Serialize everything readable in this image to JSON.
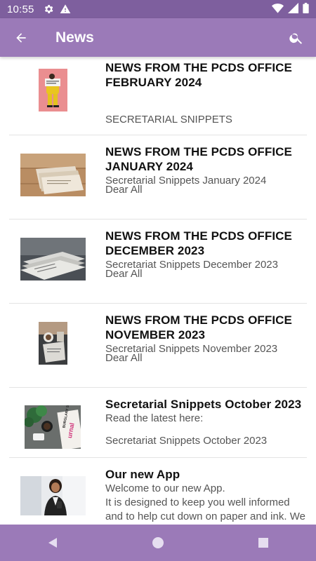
{
  "status": {
    "time": "10:55"
  },
  "app_bar": {
    "title": "News"
  },
  "items": [
    {
      "title": "NEWS FROM THE PCDS OFFICE FEBRUARY 2024",
      "subtitle": "",
      "footer": "SECRETARIAL SNIPPETS"
    },
    {
      "title": "NEWS FROM THE PCDS OFFICE JANUARY 2024",
      "subtitle": "Secretarial Snippets January 2024",
      "footer": "Dear All"
    },
    {
      "title": "NEWS FROM THE PCDS OFFICE DECEMBER 2023",
      "subtitle": "Secretariat Snippets December 2023",
      "footer": "Dear All"
    },
    {
      "title": "NEWS FROM THE PCDS OFFICE NOVEMBER 2023",
      "subtitle": "Secretarial Snippets November 2023",
      "footer": "Dear All"
    },
    {
      "title": "Secretarial Snippets October 2023",
      "subtitle": "Read the latest here:",
      "footer": "Secretariat Snippets October 2023"
    },
    {
      "title": "Our new App",
      "subtitle": "Welcome to our new App.",
      "line2": "It is designed to keep you well informed",
      "line3": "and to help cut down on paper and ink. We"
    }
  ],
  "thumbnail_text": {
    "magazine": "urnal",
    "headline": "BURGLARY SHOCK FOR"
  },
  "colors": {
    "status_bar": "#7e5f9e",
    "app_bar": "#9b7ab8",
    "nav_bar": "#9b7ab8",
    "divider": "#e3e3e3"
  }
}
